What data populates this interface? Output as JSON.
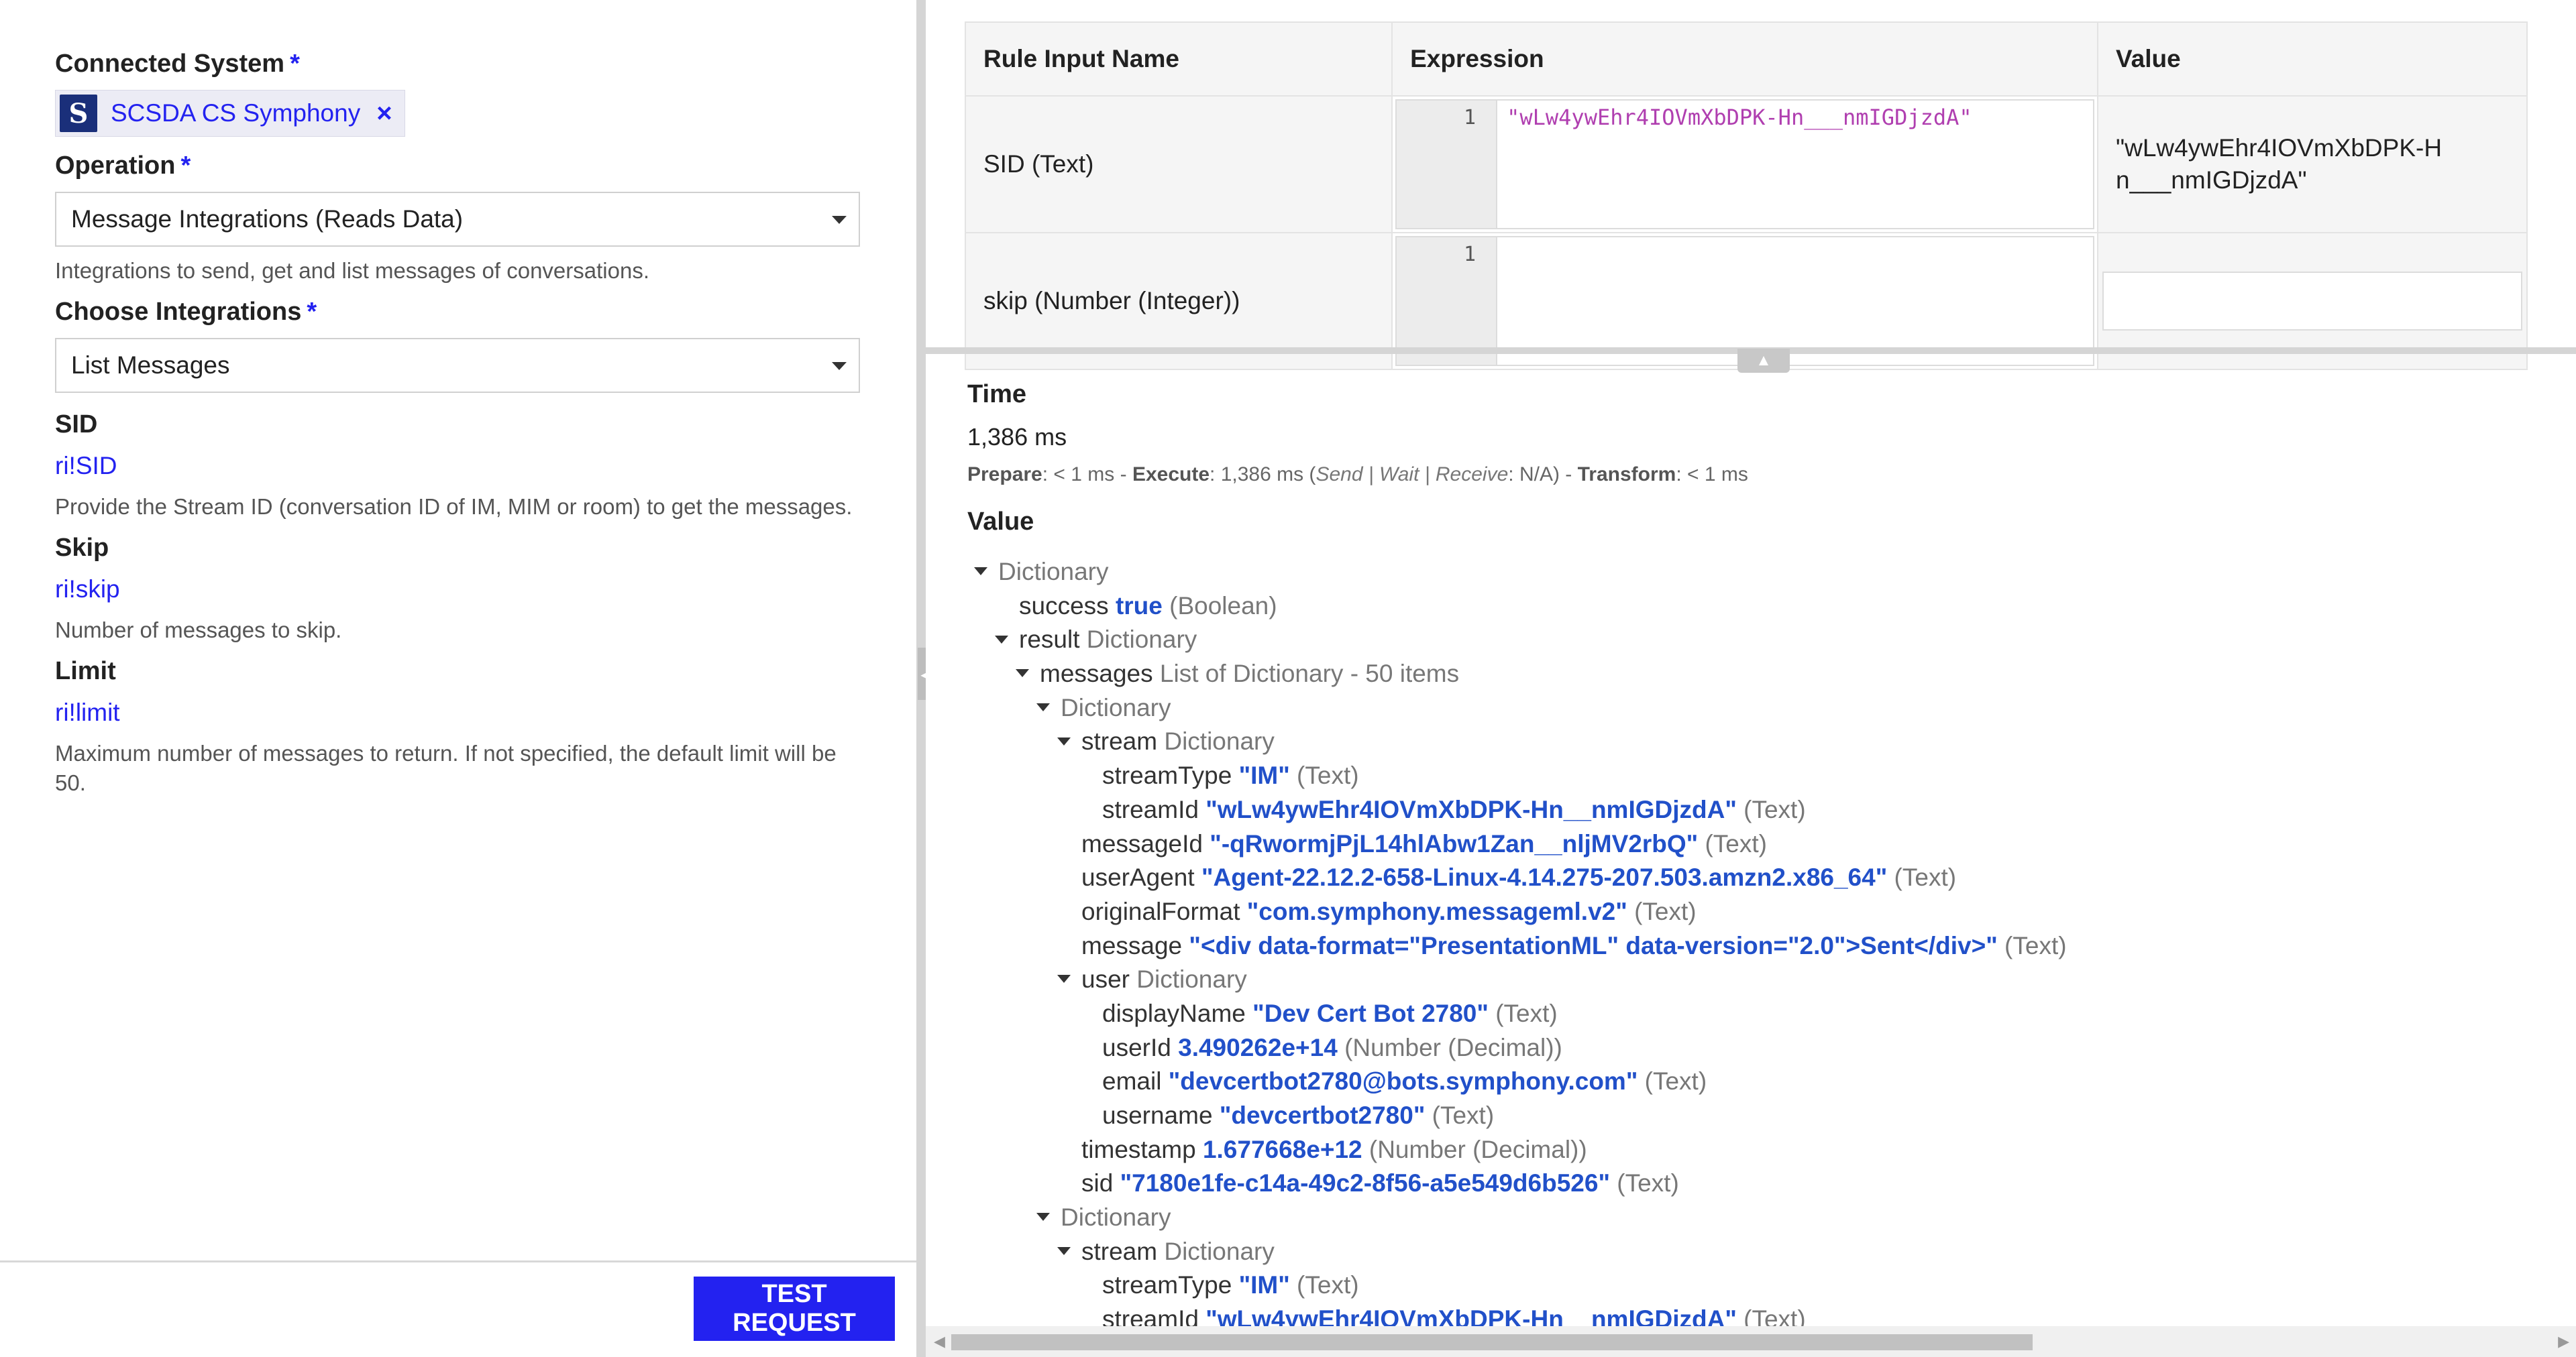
{
  "left": {
    "connected_system": {
      "label": "Connected System",
      "required": "*",
      "chip_logo": "S",
      "chip_label": "SCSDA CS Symphony",
      "remove_icon": "×"
    },
    "operation": {
      "label": "Operation",
      "required": "*",
      "value": "Message Integrations (Reads Data)",
      "help": "Integrations to send, get and list messages of conversations."
    },
    "choose_integrations": {
      "label": "Choose Integrations",
      "required": "*",
      "value": "List Messages"
    },
    "sid": {
      "label": "SID",
      "link": "ri!SID",
      "help": "Provide the Stream ID (conversation ID of IM, MIM or room) to get the messages."
    },
    "skip": {
      "label": "Skip",
      "link": "ri!skip",
      "help": "Number of messages to skip."
    },
    "limit": {
      "label": "Limit",
      "link": "ri!limit",
      "help": "Maximum number of messages to return. If not specified, the default limit will be 50."
    },
    "test_button": "TEST REQUEST"
  },
  "rule_table": {
    "headers": [
      "Rule Input Name",
      "Expression",
      "Value"
    ],
    "rows": [
      {
        "name": "SID (Text)",
        "line": "1",
        "expression": "\"wLw4ywEhr4IOVmXbDPK-Hn___nmIGDjzdA\"",
        "value": "\"wLw4ywEhr4IOVmXbDPK-Hn___nmIGDjzdA\""
      },
      {
        "name": "skip (Number (Integer))",
        "line": "1",
        "expression": "",
        "value": ""
      }
    ]
  },
  "results": {
    "time_title": "Time",
    "time_value": "1,386 ms",
    "breakdown": {
      "prepare_label": "Prepare",
      "prepare_val": ": < 1 ms - ",
      "execute_label": "Execute",
      "execute_val": ": 1,386 ms (",
      "sub": "Send | Wait | Receive",
      "sub_val": ": N/A) - ",
      "transform_label": "Transform",
      "transform_val": ": < 1 ms"
    },
    "value_title": "Value",
    "tree": [
      {
        "depth": 0,
        "toggle": true,
        "key": "",
        "val": "",
        "type": "Dictionary"
      },
      {
        "depth": 1,
        "toggle": false,
        "key": "success",
        "val": "true",
        "type": "(Boolean)"
      },
      {
        "depth": 1,
        "toggle": true,
        "key": "result",
        "val": "",
        "type": "Dictionary"
      },
      {
        "depth": 2,
        "toggle": true,
        "key": "messages",
        "val": "",
        "type": "List of Dictionary - 50 items"
      },
      {
        "depth": 3,
        "toggle": true,
        "key": "",
        "val": "",
        "type": "Dictionary"
      },
      {
        "depth": 4,
        "toggle": true,
        "key": "stream",
        "val": "",
        "type": "Dictionary"
      },
      {
        "depth": 5,
        "toggle": false,
        "key": "streamType",
        "val": "\"IM\"",
        "type": "(Text)"
      },
      {
        "depth": 5,
        "toggle": false,
        "key": "streamId",
        "val": "\"wLw4ywEhr4IOVmXbDPK-Hn__nmIGDjzdA\"",
        "type": "(Text)"
      },
      {
        "depth": 4,
        "toggle": false,
        "key": "messageId",
        "val": "\"-qRwormjPjL14hlAbw1Zan__nljMV2rbQ\"",
        "type": "(Text)"
      },
      {
        "depth": 4,
        "toggle": false,
        "key": "userAgent",
        "val": "\"Agent-22.12.2-658-Linux-4.14.275-207.503.amzn2.x86_64\"",
        "type": "(Text)"
      },
      {
        "depth": 4,
        "toggle": false,
        "key": "originalFormat",
        "val": "\"com.symphony.messageml.v2\"",
        "type": "(Text)"
      },
      {
        "depth": 4,
        "toggle": false,
        "key": "message",
        "val": "\"<div data-format=\"PresentationML\" data-version=\"2.0\">Sent</div>\"",
        "type": "(Text)"
      },
      {
        "depth": 4,
        "toggle": true,
        "key": "user",
        "val": "",
        "type": "Dictionary"
      },
      {
        "depth": 5,
        "toggle": false,
        "key": "displayName",
        "val": "\"Dev Cert Bot 2780\"",
        "type": "(Text)"
      },
      {
        "depth": 5,
        "toggle": false,
        "key": "userId",
        "val": "3.490262e+14",
        "type": "(Number (Decimal))"
      },
      {
        "depth": 5,
        "toggle": false,
        "key": "email",
        "val": "\"devcertbot2780@bots.symphony.com\"",
        "type": "(Text)"
      },
      {
        "depth": 5,
        "toggle": false,
        "key": "username",
        "val": "\"devcertbot2780\"",
        "type": "(Text)"
      },
      {
        "depth": 4,
        "toggle": false,
        "key": "timestamp",
        "val": "1.677668e+12",
        "type": "(Number (Decimal))"
      },
      {
        "depth": 4,
        "toggle": false,
        "key": "sid",
        "val": "\"7180e1fe-c14a-49c2-8f56-a5e549d6b526\"",
        "type": "(Text)"
      },
      {
        "depth": 3,
        "toggle": true,
        "key": "",
        "val": "",
        "type": "Dictionary"
      },
      {
        "depth": 4,
        "toggle": true,
        "key": "stream",
        "val": "",
        "type": "Dictionary"
      },
      {
        "depth": 5,
        "toggle": false,
        "key": "streamType",
        "val": "\"IM\"",
        "type": "(Text)"
      },
      {
        "depth": 5,
        "toggle": false,
        "key": "streamId",
        "val": "\"wLw4ywEhr4IOVmXbDPK-Hn__nmIGDjzdA\"",
        "type": "(Text)"
      }
    ]
  },
  "colors": {
    "accent": "#2322f0",
    "value_blue": "#2150c9",
    "expression": "#b03fb0"
  }
}
